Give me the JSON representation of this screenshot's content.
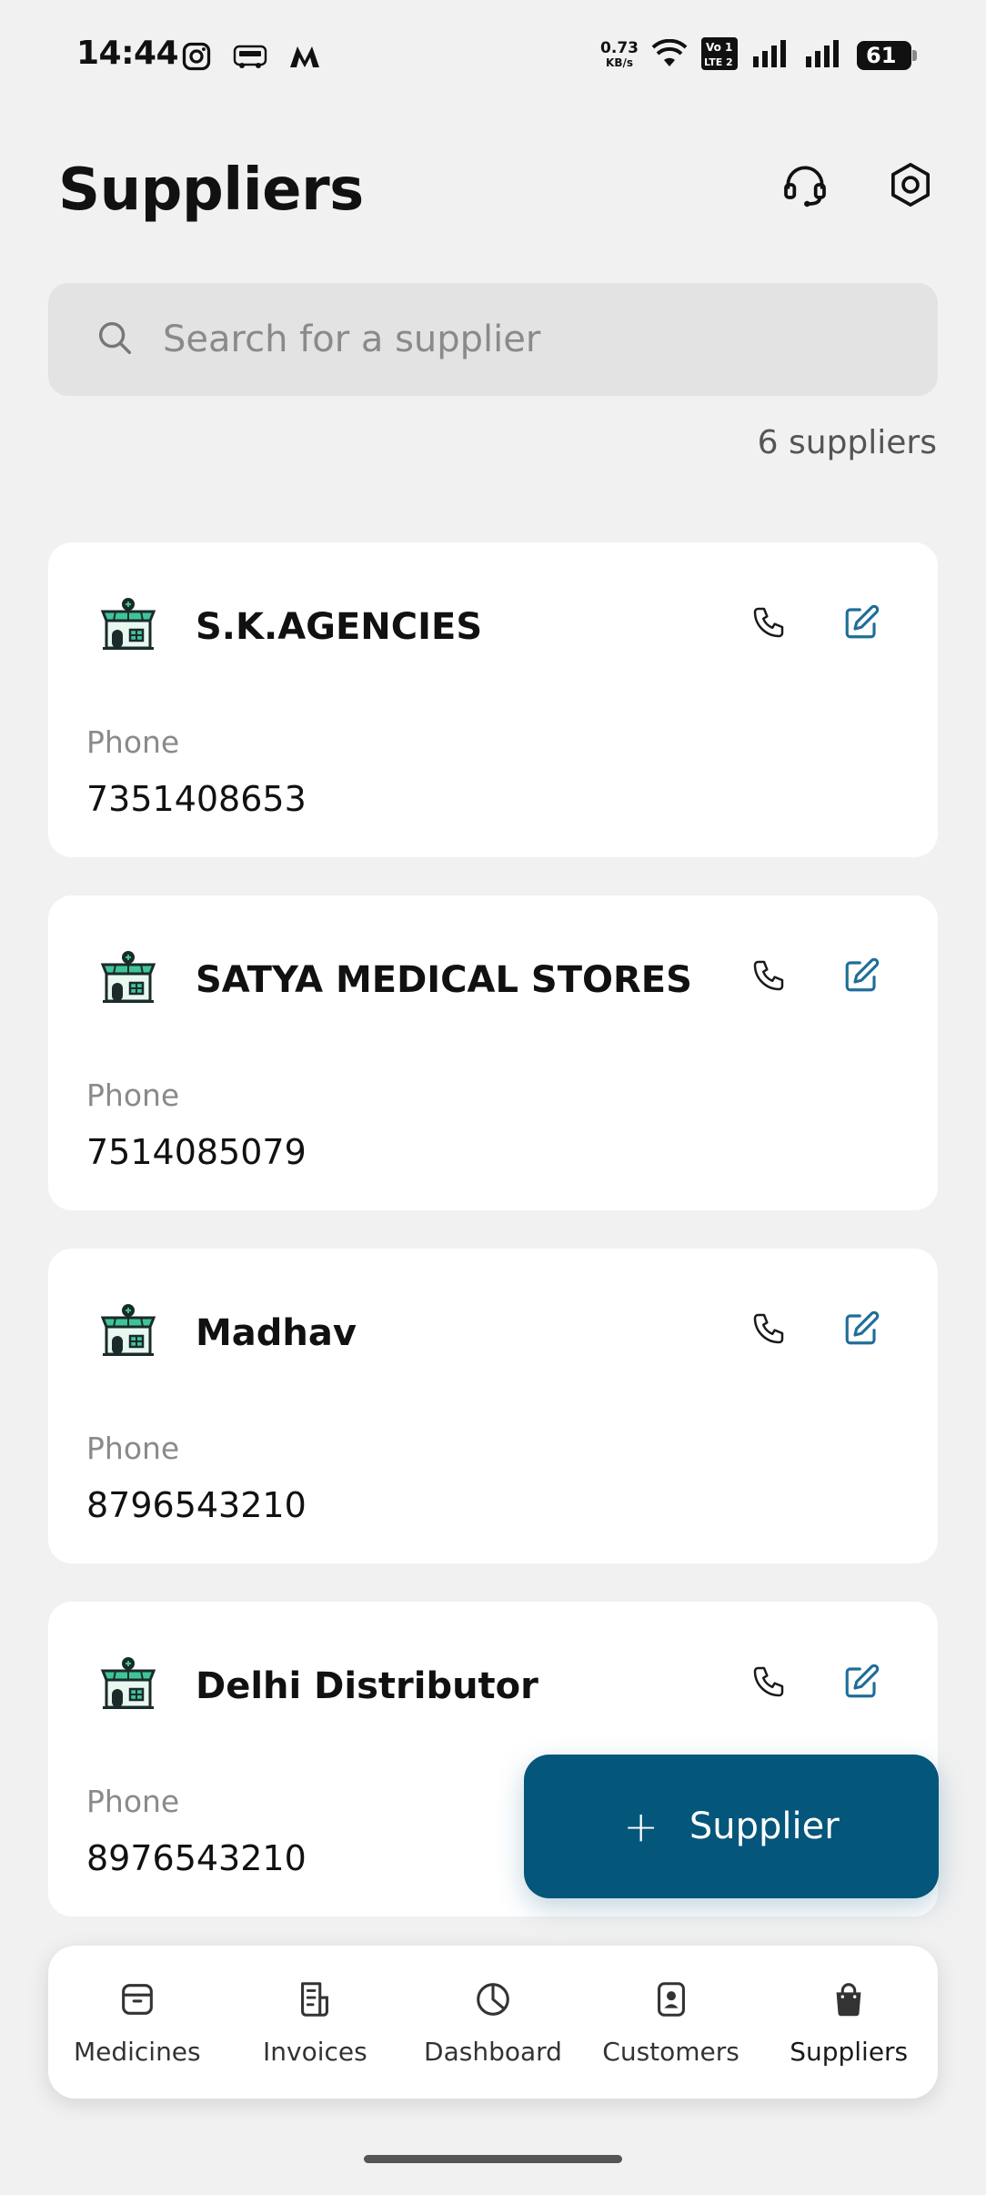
{
  "status_bar": {
    "time": "14:44",
    "net_speed_value": "0.73",
    "net_speed_unit": "KB/s",
    "battery": "61",
    "icons": [
      "instagram-icon",
      "redbus-icon",
      "myntra-icon",
      "wifi-icon",
      "volte-icon",
      "signal-icon",
      "signal-icon",
      "battery-icon"
    ]
  },
  "header": {
    "title": "Suppliers",
    "icons": [
      "headset-icon",
      "settings-icon"
    ]
  },
  "search": {
    "placeholder": "Search for a supplier",
    "value": ""
  },
  "supplier_count": "6 suppliers",
  "suppliers": [
    {
      "name": "S.K.AGENCIES",
      "phone_label": "Phone",
      "phone": "7351408653"
    },
    {
      "name": "SATYA MEDICAL STORES",
      "phone_label": "Phone",
      "phone": "7514085079"
    },
    {
      "name": "Madhav",
      "phone_label": "Phone",
      "phone": "8796543210"
    },
    {
      "name": "Delhi Distributor",
      "phone_label": "Phone",
      "phone": "8976543210"
    }
  ],
  "fab": {
    "plus": "+",
    "label": "Supplier"
  },
  "bottom_nav": {
    "items": [
      {
        "label": "Medicines",
        "icon": "box-icon"
      },
      {
        "label": "Invoices",
        "icon": "invoice-icon"
      },
      {
        "label": "Dashboard",
        "icon": "pie-chart-icon"
      },
      {
        "label": "Customers",
        "icon": "contact-card-icon"
      },
      {
        "label": "Suppliers",
        "icon": "shopping-bag-icon"
      }
    ],
    "active": "Suppliers"
  },
  "colors": {
    "accent": "#04567a",
    "edit_icon": "#1e6e98",
    "background": "#f1f1f1",
    "card": "#ffffff",
    "store_awning": "#3fc49a"
  }
}
